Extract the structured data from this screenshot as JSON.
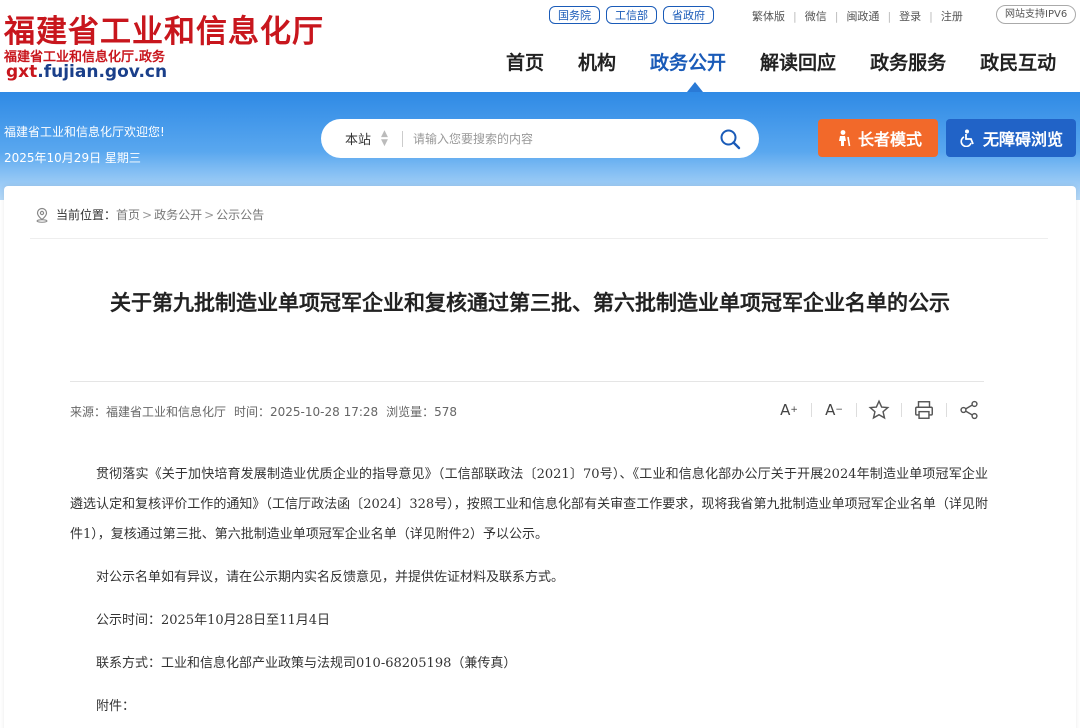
{
  "header": {
    "logo_title": "福建省工业和信息化厅",
    "logo_subtitle": "福建省工业和信息化厅.政务",
    "logo_url_prefix": "gxt",
    "logo_url_rest": ".fujian.gov.cn",
    "top_links": [
      "国务院",
      "工信部",
      "省政府"
    ],
    "util_links": [
      "繁体版",
      "微信",
      "闽政通",
      "登录",
      "注册"
    ],
    "ipv6_badge": "网站支持IPV6",
    "nav": [
      "首页",
      "机构",
      "政务公开",
      "解读回应",
      "政务服务",
      "政民互动"
    ],
    "active_nav": "政务公开"
  },
  "banner": {
    "welcome": "福建省工业和信息化厅欢迎您!",
    "date": "2025年10月29日  星期三",
    "search_scope": "本站",
    "search_placeholder": "请输入您要搜索的内容",
    "elder_mode": "长者模式",
    "accessible": "无障碍浏览"
  },
  "breadcrumb": {
    "label": "当前位置：",
    "items": [
      "首页",
      "政务公开",
      "公示公告"
    ]
  },
  "article": {
    "title": "关于第九批制造业单项冠军企业和复核通过第三批、第六批制造业单项冠军企业名单的公示",
    "source": "来源：福建省工业和信息化厅",
    "time": "时间：2025-10-28 17:28",
    "views": "浏览量：578",
    "paragraphs": [
      "贯彻落实《关于加快培育发展制造业优质企业的指导意见》（工信部联政法〔2021〕70号）、《工业和信息化部办公厅关于开展2024年制造业单项冠军企业遴选认定和复核评价工作的通知》（工信厅政法函〔2024〕328号），按照工业和信息化部有关审查工作要求，现将我省第九批制造业单项冠军企业名单（详见附件1），复核通过第三批、第六批制造业单项冠军企业名单（详见附件2）予以公示。",
      "对公示名单如有异议，请在公示期内实名反馈意见，并提供佐证材料及联系方式。",
      "公示时间：2025年10月28日至11月4日",
      "联系方式：工业和信息化部产业政策与法规司010-68205198（兼传真）",
      "附件："
    ]
  },
  "colors": {
    "brand_red": "#c8161d",
    "brand_blue": "#1a5bb8",
    "elder_orange": "#f2692a",
    "access_blue": "#2163c7"
  }
}
